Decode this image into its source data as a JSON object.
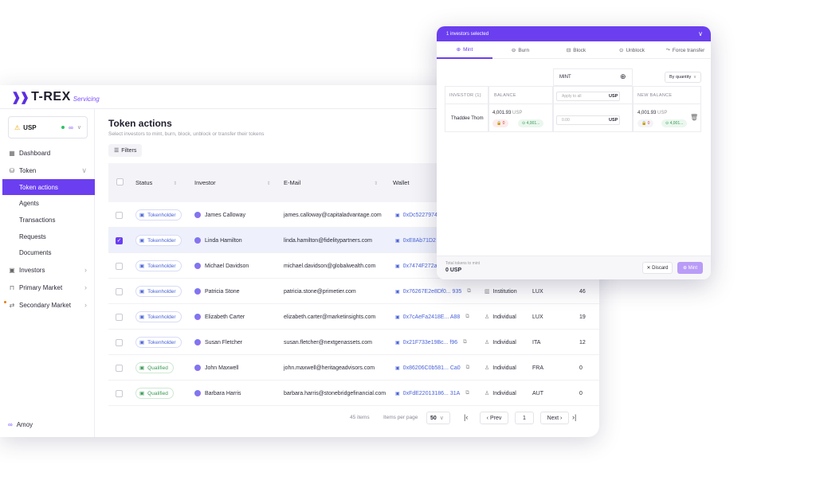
{
  "app": {
    "logo": "T-REX",
    "logo_sub": "Servicing",
    "logo_mark": "❱❱"
  },
  "sidebar": {
    "token": {
      "name": "USP"
    },
    "items": [
      {
        "label": "Dashboard",
        "icon": "dashboard-icon"
      },
      {
        "label": "Token",
        "icon": "token-icon"
      },
      {
        "label": "Token actions"
      },
      {
        "label": "Agents"
      },
      {
        "label": "Transactions"
      },
      {
        "label": "Requests"
      },
      {
        "label": "Documents"
      },
      {
        "label": "Investors",
        "icon": "investors-icon"
      },
      {
        "label": "Primary Market",
        "icon": "bag-icon"
      },
      {
        "label": "Secondary Market",
        "icon": "swap-icon"
      }
    ],
    "network": "Amoy"
  },
  "main": {
    "title": "Token actions",
    "subtitle": "Select investors to mint, burn, block, unblock or transfer their tokens",
    "filters_label": "Filters",
    "columns": {
      "status": "Status",
      "investor": "Investor",
      "email": "E-Mail",
      "wallet": "Wallet"
    },
    "rows": [
      {
        "status": "Tokenholder",
        "investor": "James Calloway",
        "email": "james.calloway@capitaladvantage.com",
        "wallet": "0xDc5227974",
        "type": "",
        "country": "",
        "balance": "",
        "selected": false
      },
      {
        "status": "Tokenholder",
        "investor": "Linda Hamilton",
        "email": "linda.hamilton@fidelitypartners.com",
        "wallet": "0xE8Ab71D2",
        "type": "",
        "country": "",
        "balance": "",
        "selected": true
      },
      {
        "status": "Tokenholder",
        "investor": "Michael Davidson",
        "email": "michael.davidson@globalwealth.com",
        "wallet": "0x7474F272a",
        "type": "",
        "country": "",
        "balance": "",
        "selected": false
      },
      {
        "status": "Tokenholder",
        "investor": "Patricia Stone",
        "email": "patricia.stone@primetier.com",
        "wallet": "0x76267E2e8Df0... 935",
        "type": "Institution",
        "country": "LUX",
        "balance": "46",
        "selected": false
      },
      {
        "status": "Tokenholder",
        "investor": "Elizabeth Carter",
        "email": "elizabeth.carter@marketinsights.com",
        "wallet": "0x7cAeFa2418E... A88",
        "type": "Individual",
        "country": "LUX",
        "balance": "19",
        "selected": false
      },
      {
        "status": "Tokenholder",
        "investor": "Susan Fletcher",
        "email": "susan.fletcher@nextgenassets.com",
        "wallet": "0x21F733e19Bc... f96",
        "type": "Individual",
        "country": "ITA",
        "balance": "12",
        "selected": false
      },
      {
        "status": "Qualified",
        "investor": "John Maxwell",
        "email": "john.maxwell@heritageadvisors.com",
        "wallet": "0x86206C0b581... Ca0",
        "type": "Individual",
        "country": "FRA",
        "balance": "0",
        "selected": false
      },
      {
        "status": "Qualified",
        "investor": "Barbara Harris",
        "email": "barbara.harris@stonebridgefinancial.com",
        "wallet": "0xFdE22013186... 31A",
        "type": "Individual",
        "country": "AUT",
        "balance": "0",
        "selected": false
      }
    ],
    "pagination": {
      "items": "45 items",
      "per_page_label": "Items per page",
      "per_page": "50",
      "prev": "Prev",
      "page": "1",
      "next": "Next"
    }
  },
  "panel": {
    "header": "1 investors selected",
    "tabs": [
      {
        "label": "Mint",
        "icon": "plus-circle-icon"
      },
      {
        "label": "Burn",
        "icon": "minus-circle-icon"
      },
      {
        "label": "Block",
        "icon": "lock-icon"
      },
      {
        "label": "Unblock",
        "icon": "unlock-icon"
      },
      {
        "label": "Force transfer",
        "icon": "transfer-icon"
      }
    ],
    "action": "MINT",
    "sort": "By quantity",
    "col_investor": "INVESTOR (1)",
    "col_balance": "BALANCE",
    "col_new_balance": "NEW BALANCE",
    "apply_placeholder": "Apply to all",
    "unit": "USP",
    "investor_name": "Thaddee Thom",
    "balance": "4,001.93",
    "chip_red": "0",
    "chip_green": "4,001...",
    "amount_placeholder": "0.00",
    "new_balance": "4,001.93",
    "new_chip_red": "0",
    "new_chip_green": "4,001...",
    "total_label": "Total tokens to mint",
    "total_value": "0 USP",
    "discard": "Discard",
    "mint": "Mint"
  }
}
